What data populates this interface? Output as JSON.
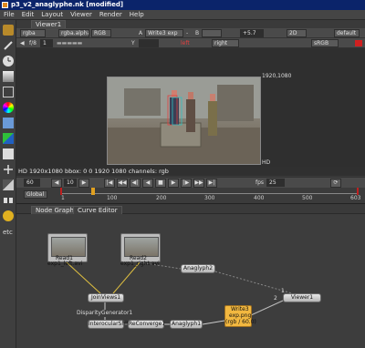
{
  "window": {
    "title": "p3_v2_anaglyphe.nk [modified]"
  },
  "menu": [
    "File",
    "Edit",
    "Layout",
    "Viewer",
    "Render",
    "Help"
  ],
  "viewer": {
    "tab": "Viewer1",
    "channels": "rgba",
    "alpha": "rgba.alpha",
    "rgb": "RGB",
    "a_label": "A",
    "a_input": "Write3 exp",
    "dash": "-",
    "b_label": "B",
    "gain": "+5.7",
    "view_mode": "2D",
    "lut": "default",
    "f_stop_label": "f/8",
    "frame_num": "1",
    "y_label": "Y",
    "left_view": "left",
    "right_view": "right",
    "colorspace": "sRGB",
    "format_tr": "1920,1080",
    "format_br": "HD",
    "status": "HD 1920x1080 bbox: 0 0 1920 1080 channels: rgb"
  },
  "transport": {
    "current_frame": "60",
    "increment": "10",
    "fps_label": "fps",
    "fps": "25",
    "scope": "Global"
  },
  "timeline": {
    "ticks": [
      "1",
      "100",
      "200",
      "300",
      "400",
      "500",
      "603"
    ]
  },
  "node_graph_tabs": [
    "Node Graph",
    "Curve Editor"
  ],
  "nodes": {
    "read1": {
      "name": "Read1",
      "file": "exp1_left.avi"
    },
    "read2": {
      "name": "Read2",
      "file": "exp1_right.avi"
    },
    "anaglyph2": "Anaglyph2",
    "joinviews": "JoinViews1",
    "disparity": "DisparityGenerator1",
    "interocular": "InterocularShift1",
    "reconverge": "ReConverge1",
    "anaglyph1": "Anaglyph1",
    "write3": {
      "name": "Write3",
      "file": "exp.png",
      "info": "(rgb / 60.0)"
    },
    "viewer1": "Viewer1",
    "pipe_labels": {
      "one": "1",
      "two": "2"
    }
  }
}
